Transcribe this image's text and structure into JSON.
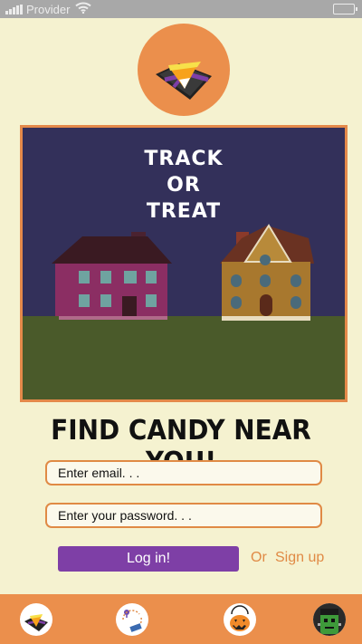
{
  "status_bar": {
    "carrier": "Provider"
  },
  "hero": {
    "title_lines": [
      "TRACK",
      "OR",
      "TREAT"
    ]
  },
  "headline": "FIND CANDY NEAR YOU!",
  "form": {
    "email_placeholder": "Enter email. . .",
    "password_placeholder": "Enter your password. . ."
  },
  "actions": {
    "login_label": "Log in!",
    "or_label": "Or",
    "signup_label": "Sign up"
  },
  "colors": {
    "accent_orange": "#eb8f4c",
    "primary_purple": "#7e3fa6",
    "background": "#f5f2d0",
    "night_sky": "#33305a",
    "grass": "#4a5a2a"
  },
  "bottom_nav": [
    {
      "icon": "candy-map-icon"
    },
    {
      "icon": "route-icon"
    },
    {
      "icon": "pumpkin-bucket-icon"
    },
    {
      "icon": "frankenstein-avatar-icon"
    }
  ]
}
